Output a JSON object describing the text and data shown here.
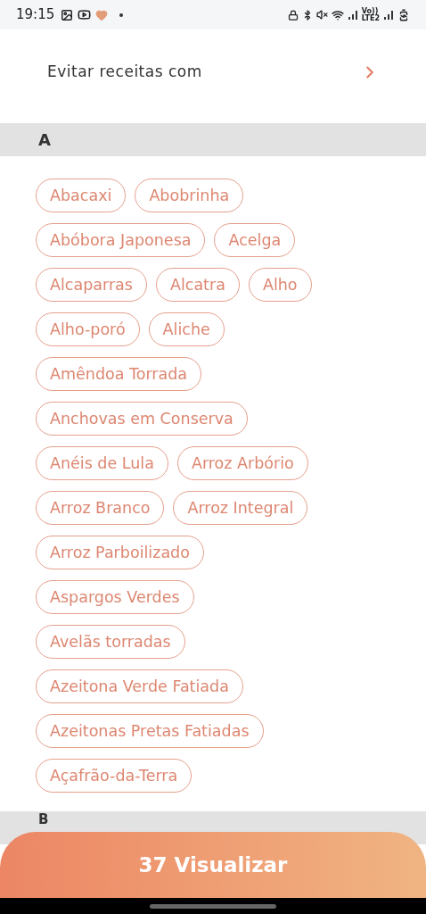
{
  "status_bar": {
    "time": "19:15",
    "network_label_top": "Vo))",
    "network_label_bottom": "LTE2"
  },
  "header": {
    "title": "Evitar receitas com"
  },
  "sections": [
    {
      "letter": "A",
      "items": [
        {
          "label": "Abacaxi",
          "selected": false
        },
        {
          "label": "Abobrinha",
          "selected": false
        },
        {
          "label": "Abóbora Japonesa",
          "selected": false
        },
        {
          "label": "Acelga",
          "selected": false
        },
        {
          "label": "Alcaparras",
          "selected": false
        },
        {
          "label": "Alcatra",
          "selected": false
        },
        {
          "label": "Alho",
          "selected": false
        },
        {
          "label": "Alho-poró",
          "selected": false
        },
        {
          "label": "Aliche",
          "selected": false
        },
        {
          "label": "Amêndoa Torrada",
          "selected": false
        },
        {
          "label": "Anchovas em Conserva",
          "selected": false
        },
        {
          "label": "Anéis de Lula",
          "selected": false
        },
        {
          "label": "Arroz Arbório",
          "selected": false
        },
        {
          "label": "Arroz Branco",
          "selected": false
        },
        {
          "label": "Arroz Integral",
          "selected": false
        },
        {
          "label": "Arroz Parboilizado",
          "selected": false
        },
        {
          "label": "Aspargos Verdes",
          "selected": false
        },
        {
          "label": "Avelãs torradas",
          "selected": false
        },
        {
          "label": "Azeitona Verde Fatiada",
          "selected": false
        },
        {
          "label": "Azeitonas Pretas Fatiadas",
          "selected": false
        },
        {
          "label": "Açafrão-da-Terra",
          "selected": false
        }
      ]
    },
    {
      "letter": "B"
    }
  ],
  "action_button": {
    "label": "37 Visualizar"
  }
}
